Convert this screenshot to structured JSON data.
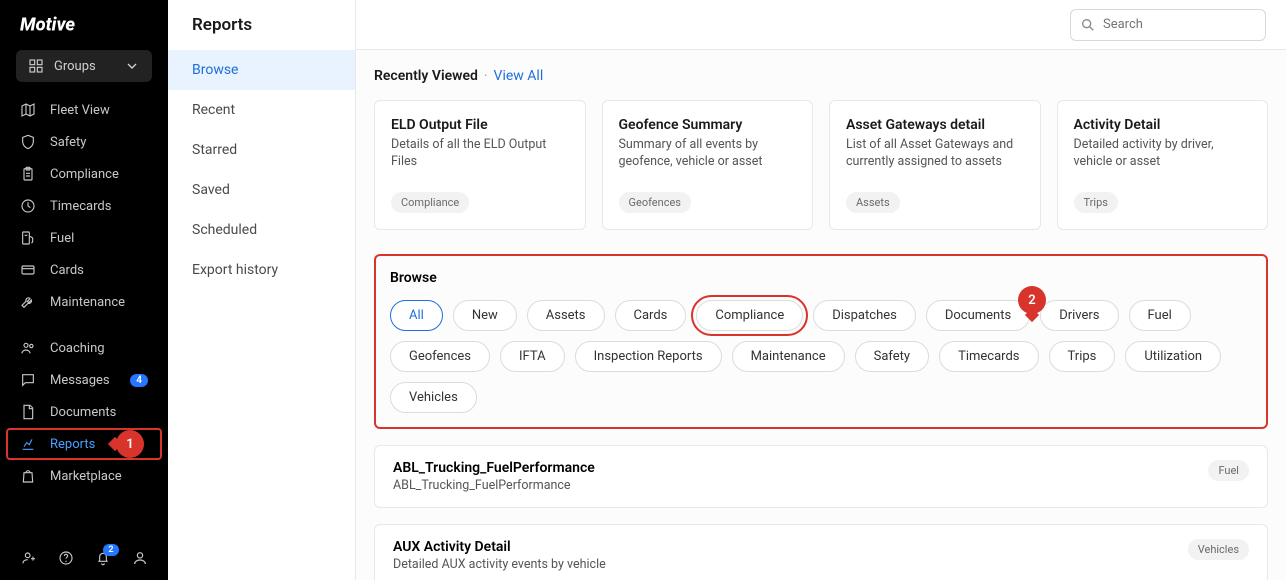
{
  "brand": "Motive",
  "groups_label": "Groups",
  "sidebar": [
    {
      "label": "Fleet View",
      "icon": "map"
    },
    {
      "label": "Safety",
      "icon": "shield"
    },
    {
      "label": "Compliance",
      "icon": "clipboard"
    },
    {
      "label": "Timecards",
      "icon": "clock"
    },
    {
      "label": "Fuel",
      "icon": "fuel"
    },
    {
      "label": "Cards",
      "icon": "card"
    },
    {
      "label": "Maintenance",
      "icon": "wrench"
    }
  ],
  "sidebar2": [
    {
      "label": "Coaching",
      "icon": "users"
    },
    {
      "label": "Messages",
      "icon": "chat",
      "badge": "4"
    },
    {
      "label": "Documents",
      "icon": "doc"
    },
    {
      "label": "Reports",
      "icon": "chart",
      "active": true,
      "highlighted": true
    },
    {
      "label": "Marketplace",
      "icon": "bag"
    }
  ],
  "bottom_notif_badge": "2",
  "page_title": "Reports",
  "search_placeholder": "Search",
  "subnav": [
    {
      "label": "Browse",
      "active": true
    },
    {
      "label": "Recent"
    },
    {
      "label": "Starred"
    },
    {
      "label": "Saved"
    },
    {
      "label": "Scheduled"
    },
    {
      "label": "Export history"
    }
  ],
  "recently_viewed_label": "Recently Viewed",
  "view_all_label": "View All",
  "recent_cards": [
    {
      "title": "ELD Output File",
      "desc": "Details of all the ELD Output Files",
      "tag": "Compliance"
    },
    {
      "title": "Geofence Summary",
      "desc": "Summary of all events by geofence, vehicle or asset",
      "tag": "Geofences"
    },
    {
      "title": "Asset Gateways detail",
      "desc": "List of all Asset Gateways and currently assigned to assets",
      "tag": "Assets"
    },
    {
      "title": "Activity Detail",
      "desc": "Detailed activity by driver, vehicle or asset",
      "tag": "Trips"
    }
  ],
  "browse_label": "Browse",
  "filters": [
    {
      "label": "All",
      "active": true
    },
    {
      "label": "New"
    },
    {
      "label": "Assets"
    },
    {
      "label": "Cards"
    },
    {
      "label": "Compliance",
      "highlighted": true
    },
    {
      "label": "Dispatches"
    },
    {
      "label": "Documents"
    },
    {
      "label": "Drivers"
    },
    {
      "label": "Fuel"
    },
    {
      "label": "Geofences"
    },
    {
      "label": "IFTA"
    },
    {
      "label": "Inspection Reports"
    },
    {
      "label": "Maintenance"
    },
    {
      "label": "Safety"
    },
    {
      "label": "Timecards"
    },
    {
      "label": "Trips"
    },
    {
      "label": "Utilization"
    },
    {
      "label": "Vehicles"
    }
  ],
  "reports_list": [
    {
      "title": "ABL_Trucking_FuelPerformance",
      "desc": "ABL_Trucking_FuelPerformance",
      "tag": "Fuel"
    },
    {
      "title": "AUX Activity Detail",
      "desc": "Detailed AUX activity events by vehicle",
      "tag": "Vehicles"
    }
  ],
  "markers": {
    "1": "1",
    "2": "2"
  }
}
